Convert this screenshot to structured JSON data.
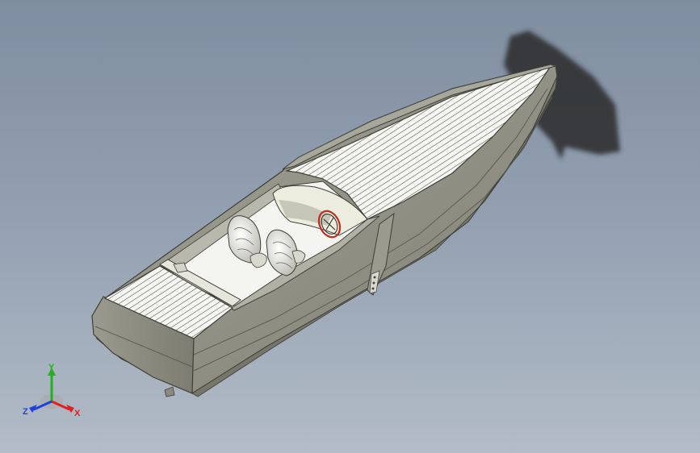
{
  "view": {
    "background_top": "#7f8da0",
    "background_bottom": "#b3bcc7"
  },
  "model": {
    "hull_color": "#8f8f83",
    "deck_plank_color": "#f4f4f0",
    "interior_color": "#f6f6f3",
    "steering_wheel_accent": "#c22a1a"
  },
  "triad": {
    "x_label": "X",
    "y_label": "Y",
    "z_label": "Z",
    "x_color": "#e02020",
    "y_color": "#20b020",
    "z_color": "#2040e0"
  }
}
